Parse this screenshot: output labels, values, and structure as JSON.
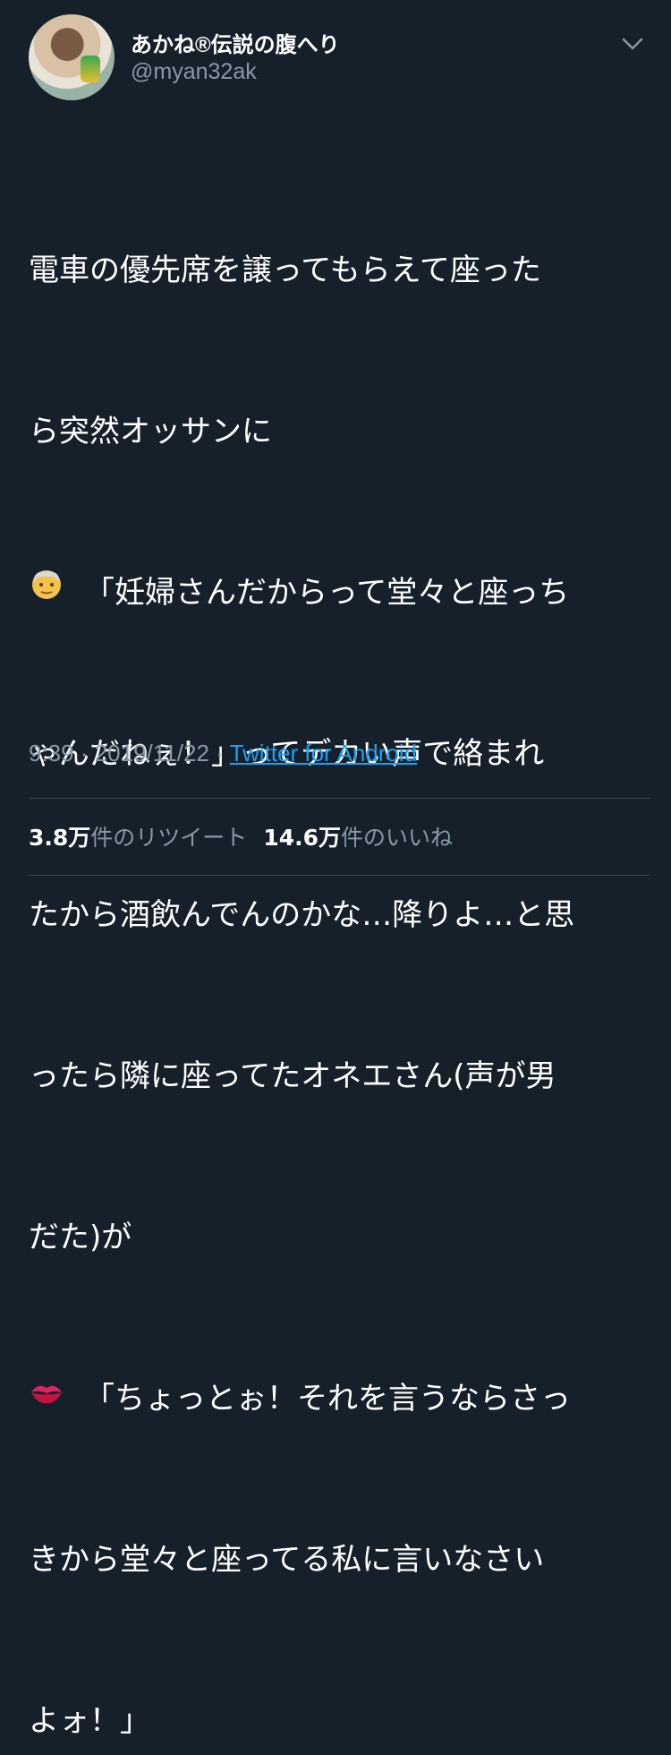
{
  "user": {
    "display_name": "あかね®伝説の腹へり",
    "handle": "@myan32ak"
  },
  "header": {
    "menu_icon": "chevron-down-icon"
  },
  "tweet": {
    "lines": [
      "電車の優先席を譲ってもらえて座った",
      "ら突然オッサンに",
      "「妊婦さんだからって堂々と座っち",
      "ゃんだねぇ！」ってデカい声で絡まれ",
      "たから酒飲んでんのかな…降りよ…と思",
      "ったら隣に座ってたオネエさん(声が男",
      "だた)が",
      "「ちょっとぉ！それを言うならさっ",
      "きから堂々と座ってる私に言いなさい",
      "よォ！」"
    ],
    "emoji_1": "older-man-emoji",
    "emoji_2": "kiss-mark-emoji"
  },
  "meta": {
    "time": "9:39",
    "sep": " · ",
    "date": "2019/11/22",
    "source": "Twitter for Android"
  },
  "stats": {
    "retweets_count": "3.8万",
    "retweets_label": "件のリツイート",
    "likes_count": "14.6万",
    "likes_label": "件のいいね"
  }
}
